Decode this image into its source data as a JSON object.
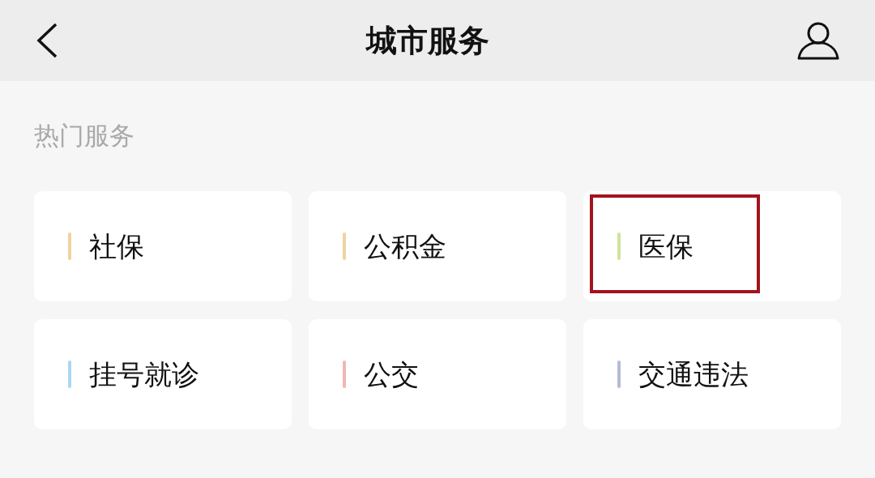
{
  "header": {
    "title": "城市服务"
  },
  "section": {
    "title": "热门服务"
  },
  "services": [
    {
      "label": "社保",
      "color": "#efd2a3",
      "highlighted": false
    },
    {
      "label": "公积金",
      "color": "#efd2a3",
      "highlighted": false
    },
    {
      "label": "医保",
      "color": "#cfe49a",
      "highlighted": true
    },
    {
      "label": "挂号就诊",
      "color": "#a9d8f1",
      "highlighted": false
    },
    {
      "label": "公交",
      "color": "#f0b7b3",
      "highlighted": false
    },
    {
      "label": "交通违法",
      "color": "#b4bbd6",
      "highlighted": false
    }
  ]
}
